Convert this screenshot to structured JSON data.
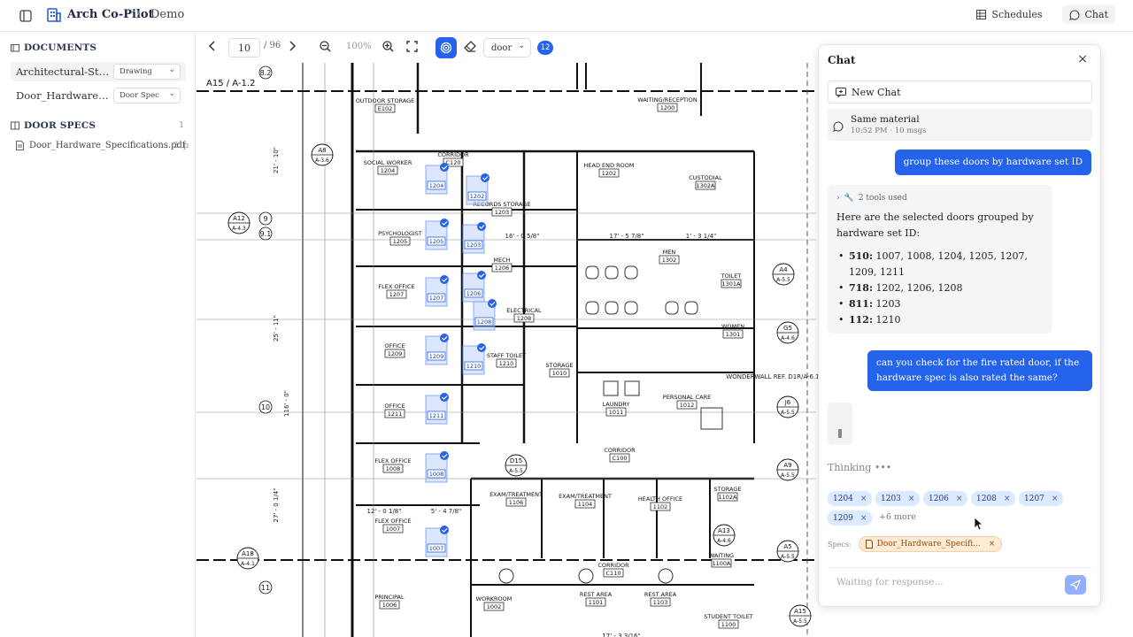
{
  "app": {
    "title": "Arch Co-Pilot",
    "separator": "/",
    "project": "Demo"
  },
  "topnav": {
    "schedules": "Schedules",
    "chat": "Chat"
  },
  "sidebar": {
    "documents_header": "DOCUMENTS",
    "documents": [
      {
        "name": "Architectural-Struct...",
        "type": "Drawing"
      },
      {
        "name": "Door_Hardware_Sp...",
        "type": "Door Spec"
      }
    ],
    "specs_header": "DOOR SPECS",
    "specs_count": "1",
    "spec_files": [
      {
        "name": "Door_Hardware_Specifications.pdf",
        "pages": "21p"
      }
    ]
  },
  "viewer": {
    "page": "10",
    "total": "/ 96",
    "zoom": "100%",
    "filter": "door",
    "selected_count": "12"
  },
  "drawing": {
    "sheet_label": "A15 / A-1.2",
    "rooms": [
      {
        "name": "OUTDOOR STORAGE",
        "num": "E102"
      },
      {
        "name": "SOCIAL WORKER",
        "num": "1204"
      },
      {
        "name": "PSYCHOLOGIST",
        "num": "1205"
      },
      {
        "name": "FLEX OFFICE",
        "num": "1207"
      },
      {
        "name": "OFFICE",
        "num": "1209"
      },
      {
        "name": "OFFICE",
        "num": "1211"
      },
      {
        "name": "FLEX OFFICE",
        "num": "1008"
      },
      {
        "name": "FLEX OFFICE",
        "num": "1007"
      },
      {
        "name": "PRINCIPAL",
        "num": "1006"
      },
      {
        "name": "RECORDS STORAGE",
        "num": "1203"
      },
      {
        "name": "MECH",
        "num": "1206"
      },
      {
        "name": "ELECTRICAL",
        "num": "1208"
      },
      {
        "name": "STAFF TOILET",
        "num": "1210"
      },
      {
        "name": "STORAGE",
        "num": "1010"
      },
      {
        "name": "LAUNDRY",
        "num": "1011"
      },
      {
        "name": "PERSONAL CARE",
        "num": "1012"
      },
      {
        "name": "WAITING/RECEPTION",
        "num": "1200"
      },
      {
        "name": "HEAD END ROOM",
        "num": "1202"
      },
      {
        "name": "CUSTODIAL",
        "num": "1302A"
      },
      {
        "name": "MEN",
        "num": "1302"
      },
      {
        "name": "WOMEN",
        "num": "1301"
      },
      {
        "name": "TOILET",
        "num": "1301A"
      },
      {
        "name": "CORRIDOR",
        "num": "C100"
      },
      {
        "name": "EXAM/TREATMENT",
        "num": "1106"
      },
      {
        "name": "EXAM/TREATMENT",
        "num": "1104"
      },
      {
        "name": "HEALTH OFFICE",
        "num": "1102"
      },
      {
        "name": "STORAGE",
        "num": "1102A"
      },
      {
        "name": "CORRIDOR",
        "num": "C110"
      },
      {
        "name": "WORKROOM",
        "num": "1002"
      },
      {
        "name": "REST AREA",
        "num": "1101"
      },
      {
        "name": "REST AREA",
        "num": "1103"
      },
      {
        "name": "STUDENT TOILET",
        "num": "1100"
      },
      {
        "name": "WAITING",
        "num": "1100A"
      },
      {
        "name": "CORRIDOR",
        "num": "C120"
      }
    ],
    "selected_doors": [
      "1204",
      "1202",
      "1205",
      "1203",
      "1207",
      "1206",
      "1208",
      "1209",
      "1210",
      "1211",
      "1008",
      "1007"
    ],
    "grid_bubbles": [
      {
        "label": "A8",
        "sub": "A-3.6"
      },
      {
        "label": "A12",
        "sub": "A-4.3"
      },
      {
        "label": "A4",
        "sub": "A-5.5"
      },
      {
        "label": "G5",
        "sub": "A-4.6"
      },
      {
        "label": "J6",
        "sub": "A-5.5"
      },
      {
        "label": "A9",
        "sub": "A-5.5"
      },
      {
        "label": "D15",
        "sub": "A-5.5"
      },
      {
        "label": "A13",
        "sub": "A-4.6"
      },
      {
        "label": "A5",
        "sub": "A-5.5"
      },
      {
        "label": "A15",
        "sub": "A-5.5"
      },
      {
        "label": "A18",
        "sub": "A-4.1"
      }
    ],
    "grid_numbers": [
      "8.2",
      "9",
      "9.1",
      "10",
      "11"
    ],
    "dims": [
      "21' - 10\"",
      "25' - 11\"",
      "116' - 0\"",
      "27' - 0 1/4\"",
      "16' - 0 5/8\"",
      "17' - 5 7/8\"",
      "1' - 3 1/4\"",
      "12' - 0 1/8\"",
      "5' - 4 7/8\"",
      "17' - 3 3/16\"",
      "WONDERWALL REF. D1R/A-6.1"
    ]
  },
  "chat": {
    "title": "Chat",
    "new_chat": "New Chat",
    "session": {
      "title": "Same material",
      "meta": "10:52 PM · 10 msgs"
    },
    "messages": {
      "user1": "group these doors by hardware set ID",
      "tools": "2 tools used",
      "bot_intro": "Here are the selected doors grouped by hardware set ID:",
      "groups": [
        {
          "id": "510:",
          "doors": " 1007, 1008, 1204, 1205, 1207, 1209, 1211"
        },
        {
          "id": "718:",
          "doors": " 1202, 1206, 1208"
        },
        {
          "id": "811:",
          "doors": " 1203"
        },
        {
          "id": "112:",
          "doors": " 1210"
        }
      ],
      "user2": "can you check for the fire rated door, if the hardware spec is also rated the same?"
    },
    "thinking": "Thinking •••",
    "chips": [
      "1204",
      "1203",
      "1206",
      "1208",
      "1207",
      "1209"
    ],
    "more": "+6 more",
    "specs_label": "Specs:",
    "spec_chip": "Door_Hardware_Specifi...",
    "input_placeholder": "Waiting for response..."
  }
}
